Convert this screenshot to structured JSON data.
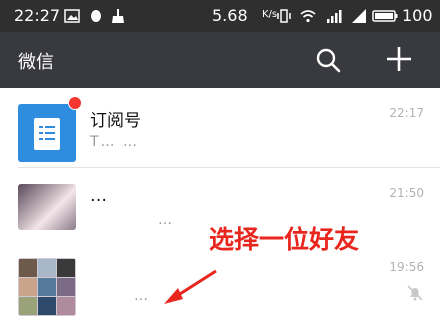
{
  "status_bar": {
    "time": "22:27",
    "speed": "5.68",
    "speed_unit": "K/s",
    "battery": "100"
  },
  "header": {
    "title": "微信"
  },
  "chats": [
    {
      "name": "订阅号",
      "time": "22:17",
      "preview": "T… …"
    },
    {
      "name": "…",
      "time": "21:50",
      "preview": "…"
    },
    {
      "name": "",
      "time": "19:56",
      "preview": "…"
    }
  ],
  "annotation": {
    "text": "选择一位好友",
    "color": "#e8261d"
  },
  "colors": {
    "header_bg": "#393a3f",
    "status_bg": "#2f2f2f",
    "badge": "#f43530",
    "subscription_avatar": "#2f8ddf"
  }
}
